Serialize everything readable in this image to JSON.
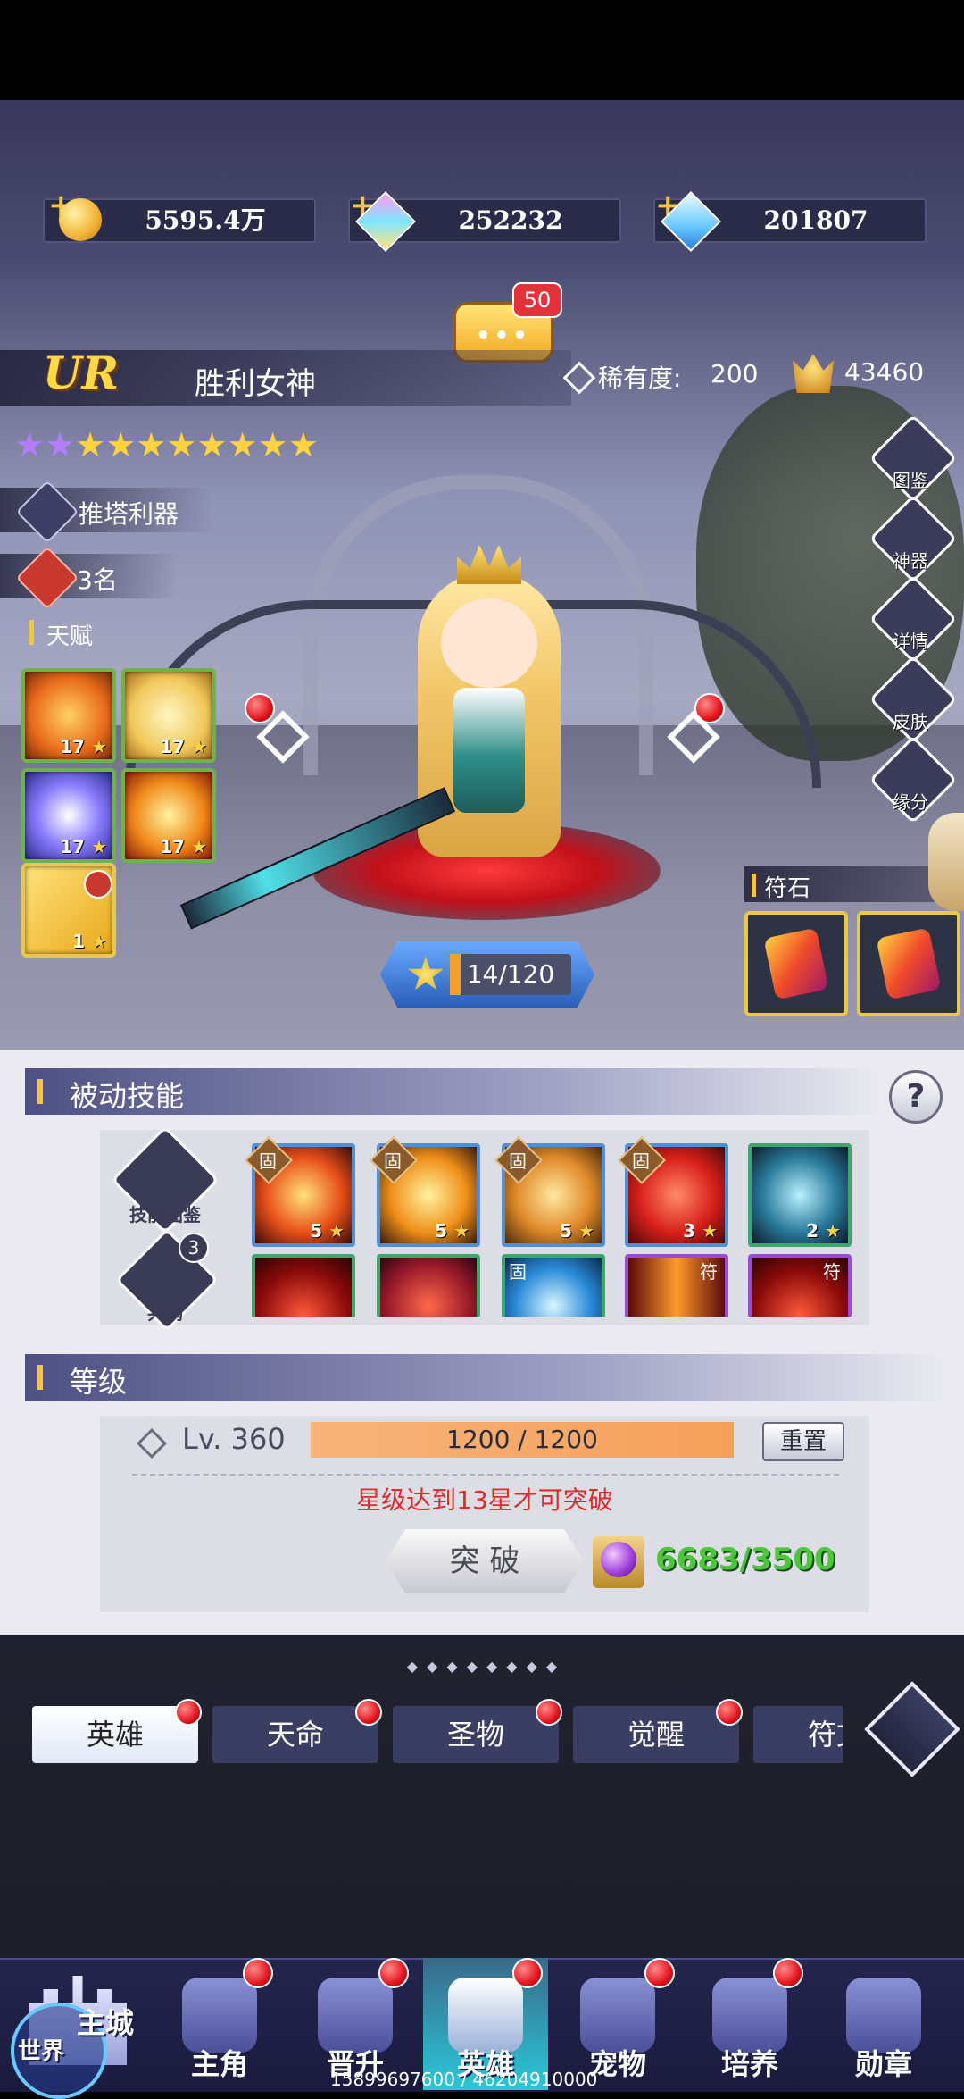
{
  "currencies": {
    "gold": "5595.4万",
    "gem_rainbow": "252232",
    "gem_blue": "201807"
  },
  "chat_badge": "50",
  "hero": {
    "rarity_tier": "UR",
    "name": "胜利女神",
    "rarity_label": "稀有度:",
    "rarity_value": "200",
    "power": "43460",
    "purple_stars": 2,
    "gold_stars": 8,
    "role_tag": "推塔利器",
    "rank": "3名",
    "talent_label": "天赋",
    "level_progress": "14/120"
  },
  "talents": [
    {
      "lv": "17"
    },
    {
      "lv": "17"
    },
    {
      "lv": "17"
    },
    {
      "lv": "17"
    },
    {
      "lv": "1"
    }
  ],
  "side_menu": [
    "图鉴",
    "神器",
    "详情",
    "皮肤",
    "缘分"
  ],
  "runestone_label": "符石",
  "passive": {
    "title": "被动技能",
    "help": "?",
    "codex_label": "技能图鉴",
    "resonance_label": "共鸣",
    "resonance_badge": "3",
    "fixed_mark": "固",
    "enhance_mark": "符",
    "row1": [
      {
        "lv": "5"
      },
      {
        "lv": "5"
      },
      {
        "lv": "5"
      },
      {
        "lv": "3"
      },
      {
        "lv": "2"
      }
    ]
  },
  "level": {
    "title": "等级",
    "lv_label": "Lv. 360",
    "exp": "1200 / 1200",
    "exp_fraction": 1.0,
    "reset": "重置",
    "warning": "星级达到13星才可突破",
    "breakthrough": "突 破",
    "cost": "6683/3500"
  },
  "tabs": [
    "英雄",
    "天命",
    "圣物",
    "觉醒",
    "符文"
  ],
  "nav": {
    "world": "世界",
    "main_city": "主城",
    "items": [
      "主角",
      "晋升",
      "英雄",
      "宠物",
      "培养",
      "勋章"
    ]
  },
  "footer_id": "15899697600 / 46204910000"
}
